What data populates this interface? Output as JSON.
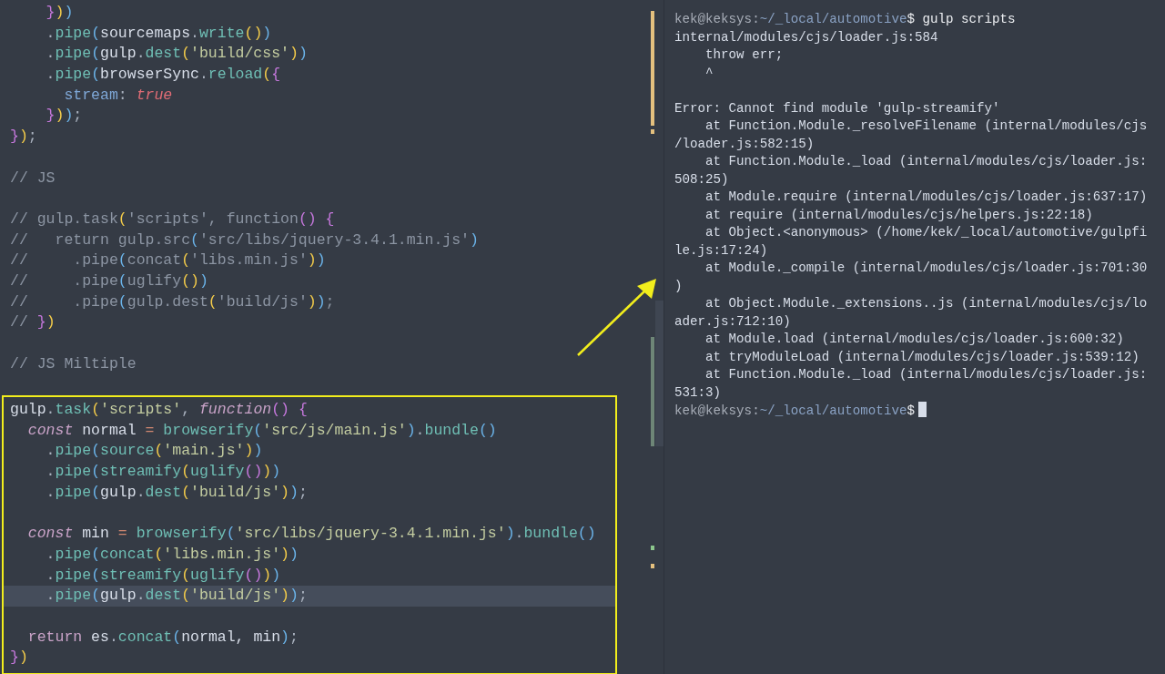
{
  "editor": {
    "lines": [
      {
        "kind": "code",
        "tokens": [
          {
            "text": "    }",
            "kind": "p"
          },
          {
            "text": ")",
            "kind": "y"
          },
          {
            "text": ")",
            "kind": "c"
          }
        ]
      },
      {
        "kind": "code",
        "tokens": [
          {
            "text": "    .",
            "kind": "d"
          },
          {
            "text": "pipe",
            "kind": "m"
          },
          {
            "text": "(",
            "kind": "c"
          },
          {
            "text": "sourcemaps",
            "kind": "t"
          },
          {
            "text": ".",
            "kind": "d"
          },
          {
            "text": "write",
            "kind": "m"
          },
          {
            "text": "()",
            "kind": "y"
          },
          {
            "text": ")",
            "kind": "c"
          }
        ]
      },
      {
        "kind": "code",
        "tokens": [
          {
            "text": "    .",
            "kind": "d"
          },
          {
            "text": "pipe",
            "kind": "m"
          },
          {
            "text": "(",
            "kind": "c"
          },
          {
            "text": "gulp",
            "kind": "t"
          },
          {
            "text": ".",
            "kind": "d"
          },
          {
            "text": "dest",
            "kind": "m"
          },
          {
            "text": "(",
            "kind": "y"
          },
          {
            "text": "'build/css'",
            "kind": "s"
          },
          {
            "text": ")",
            "kind": "y"
          },
          {
            "text": ")",
            "kind": "c"
          }
        ]
      },
      {
        "kind": "code",
        "tokens": [
          {
            "text": "    .",
            "kind": "d"
          },
          {
            "text": "pipe",
            "kind": "m"
          },
          {
            "text": "(",
            "kind": "c"
          },
          {
            "text": "browserSync",
            "kind": "t"
          },
          {
            "text": ".",
            "kind": "d"
          },
          {
            "text": "reload",
            "kind": "m"
          },
          {
            "text": "(",
            "kind": "y"
          },
          {
            "text": "{",
            "kind": "p"
          }
        ]
      },
      {
        "kind": "code",
        "tokens": [
          {
            "text": "      stream",
            "kind": "pr"
          },
          {
            "text": ": ",
            "kind": "d"
          },
          {
            "text": "true",
            "kind": "b"
          }
        ]
      },
      {
        "kind": "code",
        "tokens": [
          {
            "text": "    }",
            "kind": "p"
          },
          {
            "text": ")",
            "kind": "y"
          },
          {
            "text": ")",
            "kind": "c"
          },
          {
            "text": ";",
            "kind": "d"
          }
        ]
      },
      {
        "kind": "code",
        "tokens": [
          {
            "text": "}",
            "kind": "p"
          },
          {
            "text": ")",
            "kind": "y"
          },
          {
            "text": ";",
            "kind": "d"
          }
        ]
      },
      {
        "kind": "blank"
      },
      {
        "kind": "code",
        "tokens": [
          {
            "text": "// JS",
            "kind": "cm"
          }
        ]
      },
      {
        "kind": "blank"
      },
      {
        "kind": "code",
        "tokens": [
          {
            "text": "// gulp.task",
            "kind": "cm"
          },
          {
            "text": "(",
            "kind": "y"
          },
          {
            "text": "'scripts', function",
            "kind": "cm"
          },
          {
            "text": "()",
            "kind": "p"
          },
          {
            "text": " {",
            "kind": "p"
          }
        ]
      },
      {
        "kind": "code",
        "tokens": [
          {
            "text": "//   return gulp.src",
            "kind": "cm"
          },
          {
            "text": "(",
            "kind": "c"
          },
          {
            "text": "'src/libs/jquery-3.4.1.min.js'",
            "kind": "cm"
          },
          {
            "text": ")",
            "kind": "c"
          }
        ]
      },
      {
        "kind": "code",
        "tokens": [
          {
            "text": "//     .pipe",
            "kind": "cm"
          },
          {
            "text": "(",
            "kind": "c"
          },
          {
            "text": "concat",
            "kind": "cm"
          },
          {
            "text": "(",
            "kind": "y"
          },
          {
            "text": "'libs.min.js'",
            "kind": "cm"
          },
          {
            "text": ")",
            "kind": "y"
          },
          {
            "text": ")",
            "kind": "c"
          }
        ]
      },
      {
        "kind": "code",
        "tokens": [
          {
            "text": "//     .pipe",
            "kind": "cm"
          },
          {
            "text": "(",
            "kind": "c"
          },
          {
            "text": "uglify",
            "kind": "cm"
          },
          {
            "text": "()",
            "kind": "y"
          },
          {
            "text": ")",
            "kind": "c"
          }
        ]
      },
      {
        "kind": "code",
        "tokens": [
          {
            "text": "//     .pipe",
            "kind": "cm"
          },
          {
            "text": "(",
            "kind": "c"
          },
          {
            "text": "gulp.dest",
            "kind": "cm"
          },
          {
            "text": "(",
            "kind": "y"
          },
          {
            "text": "'build/js'",
            "kind": "cm"
          },
          {
            "text": ")",
            "kind": "y"
          },
          {
            "text": ")",
            "kind": "c"
          },
          {
            "text": ";",
            "kind": "cm"
          }
        ]
      },
      {
        "kind": "code",
        "tokens": [
          {
            "text": "// ",
            "kind": "cm"
          },
          {
            "text": "}",
            "kind": "p"
          },
          {
            "text": ")",
            "kind": "y"
          }
        ]
      },
      {
        "kind": "blank"
      },
      {
        "kind": "code",
        "tokens": [
          {
            "text": "// JS Miltiple",
            "kind": "cm"
          }
        ]
      },
      {
        "kind": "blank"
      }
    ],
    "boxed_lines": [
      {
        "kind": "code",
        "current": false,
        "tokens": [
          {
            "text": "gulp",
            "kind": "t"
          },
          {
            "text": ".",
            "kind": "d"
          },
          {
            "text": "task",
            "kind": "m"
          },
          {
            "text": "(",
            "kind": "y"
          },
          {
            "text": "'scripts'",
            "kind": "s"
          },
          {
            "text": ", ",
            "kind": "d"
          },
          {
            "text": "function",
            "kind": "k"
          },
          {
            "text": "()",
            "kind": "p"
          },
          {
            "text": " {",
            "kind": "p"
          }
        ]
      },
      {
        "kind": "code",
        "current": false,
        "tokens": [
          {
            "text": "  const",
            "kind": "k"
          },
          {
            "text": " normal ",
            "kind": "t"
          },
          {
            "text": "=",
            "kind": "o"
          },
          {
            "text": " browserify",
            "kind": "m"
          },
          {
            "text": "(",
            "kind": "c"
          },
          {
            "text": "'src/js/main.js'",
            "kind": "s"
          },
          {
            "text": ")",
            "kind": "c"
          },
          {
            "text": ".",
            "kind": "d"
          },
          {
            "text": "bundle",
            "kind": "m"
          },
          {
            "text": "()",
            "kind": "c"
          }
        ]
      },
      {
        "kind": "code",
        "current": false,
        "tokens": [
          {
            "text": "    .",
            "kind": "d"
          },
          {
            "text": "pipe",
            "kind": "m"
          },
          {
            "text": "(",
            "kind": "c"
          },
          {
            "text": "source",
            "kind": "m"
          },
          {
            "text": "(",
            "kind": "y"
          },
          {
            "text": "'main.js'",
            "kind": "s"
          },
          {
            "text": ")",
            "kind": "y"
          },
          {
            "text": ")",
            "kind": "c"
          }
        ]
      },
      {
        "kind": "code",
        "current": false,
        "tokens": [
          {
            "text": "    .",
            "kind": "d"
          },
          {
            "text": "pipe",
            "kind": "m"
          },
          {
            "text": "(",
            "kind": "c"
          },
          {
            "text": "streamify",
            "kind": "m"
          },
          {
            "text": "(",
            "kind": "y"
          },
          {
            "text": "uglify",
            "kind": "m"
          },
          {
            "text": "()",
            "kind": "p"
          },
          {
            "text": ")",
            "kind": "y"
          },
          {
            "text": ")",
            "kind": "c"
          }
        ]
      },
      {
        "kind": "code",
        "current": false,
        "tokens": [
          {
            "text": "    .",
            "kind": "d"
          },
          {
            "text": "pipe",
            "kind": "m"
          },
          {
            "text": "(",
            "kind": "c"
          },
          {
            "text": "gulp",
            "kind": "t"
          },
          {
            "text": ".",
            "kind": "d"
          },
          {
            "text": "dest",
            "kind": "m"
          },
          {
            "text": "(",
            "kind": "y"
          },
          {
            "text": "'build/js'",
            "kind": "s"
          },
          {
            "text": ")",
            "kind": "y"
          },
          {
            "text": ")",
            "kind": "c"
          },
          {
            "text": ";",
            "kind": "d"
          }
        ]
      },
      {
        "kind": "blank"
      },
      {
        "kind": "code",
        "current": false,
        "tokens": [
          {
            "text": "  const",
            "kind": "k"
          },
          {
            "text": " min ",
            "kind": "t"
          },
          {
            "text": "=",
            "kind": "o"
          },
          {
            "text": " browserify",
            "kind": "m"
          },
          {
            "text": "(",
            "kind": "c"
          },
          {
            "text": "'src/libs/jquery-3.4.1.min.js'",
            "kind": "s"
          },
          {
            "text": ")",
            "kind": "c"
          },
          {
            "text": ".",
            "kind": "d"
          },
          {
            "text": "bundle",
            "kind": "m"
          },
          {
            "text": "()",
            "kind": "c"
          }
        ]
      },
      {
        "kind": "code",
        "current": false,
        "tokens": [
          {
            "text": "    .",
            "kind": "d"
          },
          {
            "text": "pipe",
            "kind": "m"
          },
          {
            "text": "(",
            "kind": "c"
          },
          {
            "text": "concat",
            "kind": "m"
          },
          {
            "text": "(",
            "kind": "y"
          },
          {
            "text": "'libs.min.js'",
            "kind": "s"
          },
          {
            "text": ")",
            "kind": "y"
          },
          {
            "text": ")",
            "kind": "c"
          }
        ]
      },
      {
        "kind": "code",
        "current": false,
        "tokens": [
          {
            "text": "    .",
            "kind": "d"
          },
          {
            "text": "pipe",
            "kind": "m"
          },
          {
            "text": "(",
            "kind": "c"
          },
          {
            "text": "streamify",
            "kind": "m"
          },
          {
            "text": "(",
            "kind": "y"
          },
          {
            "text": "uglify",
            "kind": "m"
          },
          {
            "text": "()",
            "kind": "p"
          },
          {
            "text": ")",
            "kind": "y"
          },
          {
            "text": ")",
            "kind": "c"
          }
        ]
      },
      {
        "kind": "code",
        "current": true,
        "tokens": [
          {
            "text": "    .",
            "kind": "d"
          },
          {
            "text": "pipe",
            "kind": "m"
          },
          {
            "text": "(",
            "kind": "c"
          },
          {
            "text": "gulp",
            "kind": "t"
          },
          {
            "text": ".",
            "kind": "d"
          },
          {
            "text": "dest",
            "kind": "m"
          },
          {
            "text": "(",
            "kind": "y"
          },
          {
            "text": "'build/js'",
            "kind": "s"
          },
          {
            "text": ")",
            "kind": "y"
          },
          {
            "text": ")",
            "kind": "c"
          },
          {
            "text": ";",
            "kind": "d"
          }
        ]
      },
      {
        "kind": "blank"
      },
      {
        "kind": "code",
        "current": false,
        "tokens": [
          {
            "text": "  return",
            "kind": "k2"
          },
          {
            "text": " es",
            "kind": "t"
          },
          {
            "text": ".",
            "kind": "d"
          },
          {
            "text": "concat",
            "kind": "m"
          },
          {
            "text": "(",
            "kind": "c"
          },
          {
            "text": "normal, min",
            "kind": "t"
          },
          {
            "text": ")",
            "kind": "c"
          },
          {
            "text": ";",
            "kind": "d"
          }
        ]
      },
      {
        "kind": "code",
        "current": false,
        "tokens": [
          {
            "text": "}",
            "kind": "p"
          },
          {
            "text": ")",
            "kind": "y"
          }
        ]
      }
    ]
  },
  "terminal": {
    "lines": [
      {
        "kind": "prompt",
        "user": "kek@keksys:",
        "path": "~/_local/automotive",
        "symbol": "$",
        "command": "gulp scripts",
        "cursor": false
      },
      {
        "kind": "output",
        "text": "internal/modules/cjs/loader.js:584"
      },
      {
        "kind": "output",
        "text": "    throw err;"
      },
      {
        "kind": "output",
        "text": "    ^"
      },
      {
        "kind": "blank"
      },
      {
        "kind": "output",
        "text": "Error: Cannot find module 'gulp-streamify'"
      },
      {
        "kind": "output",
        "text": "    at Function.Module._resolveFilename (internal/modules/cjs"
      },
      {
        "kind": "output",
        "text": "/loader.js:582:15)"
      },
      {
        "kind": "output",
        "text": "    at Function.Module._load (internal/modules/cjs/loader.js:"
      },
      {
        "kind": "output",
        "text": "508:25)"
      },
      {
        "kind": "output",
        "text": "    at Module.require (internal/modules/cjs/loader.js:637:17)"
      },
      {
        "kind": "output",
        "text": "    at require (internal/modules/cjs/helpers.js:22:18)"
      },
      {
        "kind": "output",
        "text": "    at Object.<anonymous> (/home/kek/_local/automotive/gulpfi"
      },
      {
        "kind": "output",
        "text": "le.js:17:24)"
      },
      {
        "kind": "output",
        "text": "    at Module._compile (internal/modules/cjs/loader.js:701:30"
      },
      {
        "kind": "output",
        "text": ")"
      },
      {
        "kind": "output",
        "text": "    at Object.Module._extensions..js (internal/modules/cjs/lo"
      },
      {
        "kind": "output",
        "text": "ader.js:712:10)"
      },
      {
        "kind": "output",
        "text": "    at Module.load (internal/modules/cjs/loader.js:600:32)"
      },
      {
        "kind": "output",
        "text": "    at tryModuleLoad (internal/modules/cjs/loader.js:539:12)"
      },
      {
        "kind": "output",
        "text": "    at Function.Module._load (internal/modules/cjs/loader.js:"
      },
      {
        "kind": "output",
        "text": "531:3)"
      },
      {
        "kind": "prompt",
        "user": "kek@keksys:",
        "path": "~/_local/automotive",
        "symbol": "$",
        "cursor": true
      }
    ]
  }
}
